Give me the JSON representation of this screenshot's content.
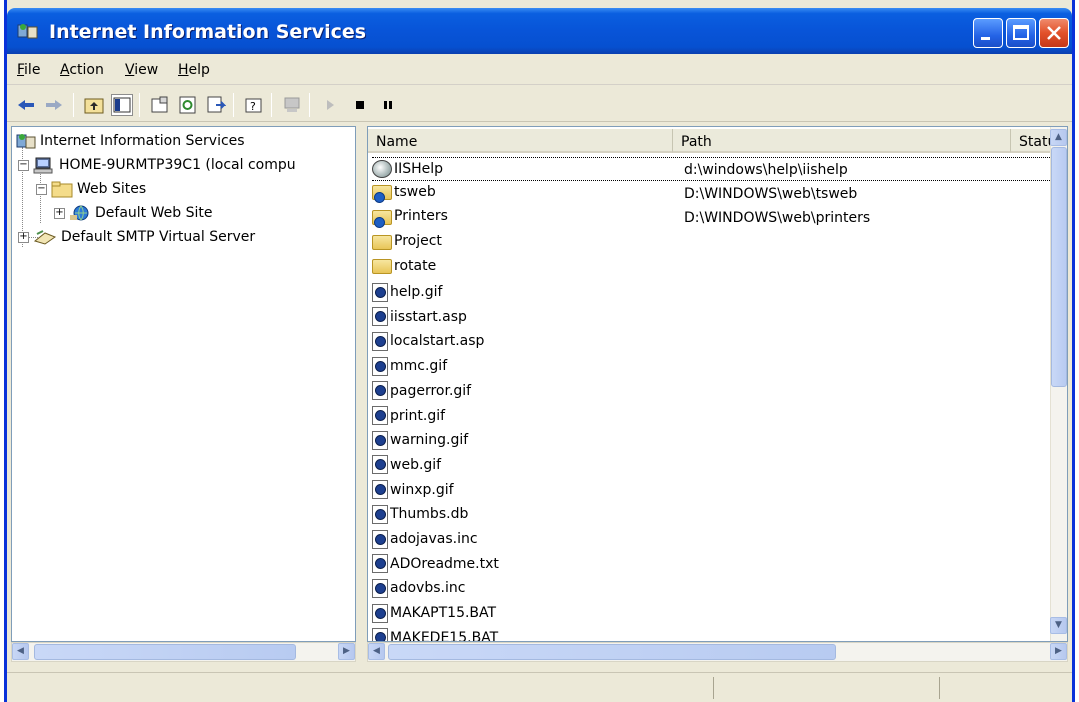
{
  "window": {
    "title": "Internet Information Services"
  },
  "menu": [
    {
      "pre": "",
      "ul": "F",
      "post": "ile"
    },
    {
      "pre": "",
      "ul": "A",
      "post": "ction"
    },
    {
      "pre": "",
      "ul": "V",
      "post": "iew"
    },
    {
      "pre": "",
      "ul": "H",
      "post": "elp"
    }
  ],
  "toolbar": {
    "icons": [
      "back-arrow-icon",
      "forward-arrow-icon",
      "up-folder-icon",
      "show-tree-icon",
      "properties-icon",
      "refresh-icon",
      "export-list-icon",
      "help-icon",
      "connect-computer-icon",
      "play-icon",
      "stop-icon",
      "pause-icon"
    ]
  },
  "tree": {
    "root": "Internet Information Services",
    "computer": "HOME-9URMTP39C1 (local compu",
    "web_sites": "Web Sites",
    "default_web_site": "Default Web Site",
    "smtp": "Default SMTP Virtual Server"
  },
  "list": {
    "columns": [
      "Name",
      "Path",
      "Statu"
    ],
    "rows": [
      {
        "name": "IISHelp",
        "path": "d:\\windows\\help\\iishelp",
        "icon": "help-globe-icon"
      },
      {
        "name": "tsweb",
        "path": "D:\\WINDOWS\\web\\tsweb",
        "icon": "virtual-directory-icon"
      },
      {
        "name": "Printers",
        "path": "D:\\WINDOWS\\web\\printers",
        "icon": "virtual-directory-icon"
      },
      {
        "name": "Project",
        "path": "",
        "icon": "folder-icon"
      },
      {
        "name": "rotate",
        "path": "",
        "icon": "folder-icon"
      },
      {
        "name": "help.gif",
        "path": "",
        "icon": "file-icon"
      },
      {
        "name": "iisstart.asp",
        "path": "",
        "icon": "file-icon"
      },
      {
        "name": "localstart.asp",
        "path": "",
        "icon": "file-icon"
      },
      {
        "name": "mmc.gif",
        "path": "",
        "icon": "file-icon"
      },
      {
        "name": "pagerror.gif",
        "path": "",
        "icon": "file-icon"
      },
      {
        "name": "print.gif",
        "path": "",
        "icon": "file-icon"
      },
      {
        "name": "warning.gif",
        "path": "",
        "icon": "file-icon"
      },
      {
        "name": "web.gif",
        "path": "",
        "icon": "file-icon"
      },
      {
        "name": "winxp.gif",
        "path": "",
        "icon": "file-icon"
      },
      {
        "name": "Thumbs.db",
        "path": "",
        "icon": "file-icon"
      },
      {
        "name": "adojavas.inc",
        "path": "",
        "icon": "file-icon"
      },
      {
        "name": "ADOreadme.txt",
        "path": "",
        "icon": "file-icon"
      },
      {
        "name": "adovbs.inc",
        "path": "",
        "icon": "file-icon"
      },
      {
        "name": "MAKAPT15.BAT",
        "path": "",
        "icon": "file-icon"
      },
      {
        "name": "MAKEDE15.BAT",
        "path": "",
        "icon": "file-icon"
      }
    ]
  },
  "colors": {
    "titlebar": "#0854d8",
    "frame": "#0831d9",
    "chrome": "#ece9d8"
  }
}
